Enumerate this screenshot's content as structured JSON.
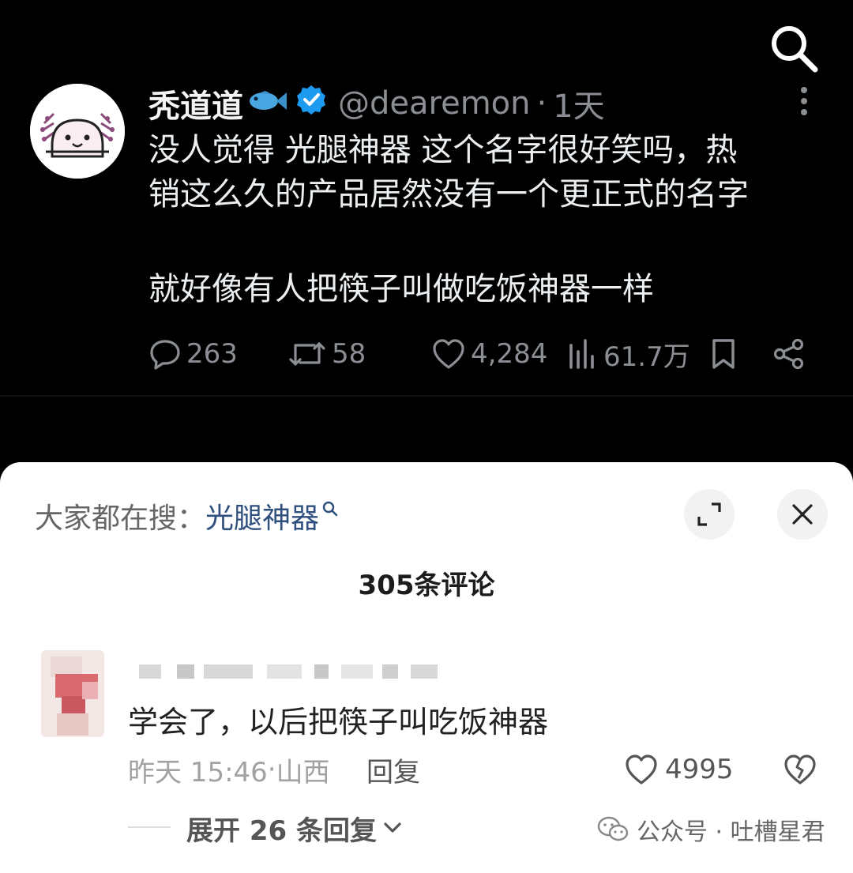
{
  "post": {
    "author_name": "秃道道",
    "author_emoji": "🐟",
    "handle": "@dearemon",
    "separator": "·",
    "time": "1天",
    "text_line1": "没人觉得 光腿神器 这个名字很好笑吗，热",
    "text_line2": "销这么久的产品居然没有一个更正式的名字",
    "text_line3": "就好像有人把筷子叫做吃饭神器一样",
    "stats": {
      "replies": "263",
      "reposts": "58",
      "likes": "4,284",
      "views": "61.7万"
    }
  },
  "sheet": {
    "trend_prefix": "大家都在搜：",
    "trend_link": "光腿神器",
    "comment_count": "305条评论"
  },
  "comment": {
    "text": "学会了，以后把筷子叫吃饭神器",
    "time": "昨天 15:46",
    "location_sep": "·",
    "location": "山西",
    "reply_label": "回复",
    "likes": "4995",
    "expand_label": "展开 26 条回复"
  },
  "watermark": {
    "label": "公众号 · 吐槽星君"
  },
  "colors": {
    "background_dark": "#000000",
    "verified_blue": "#1d9bf0",
    "trend_link": "#2f4f7f"
  }
}
